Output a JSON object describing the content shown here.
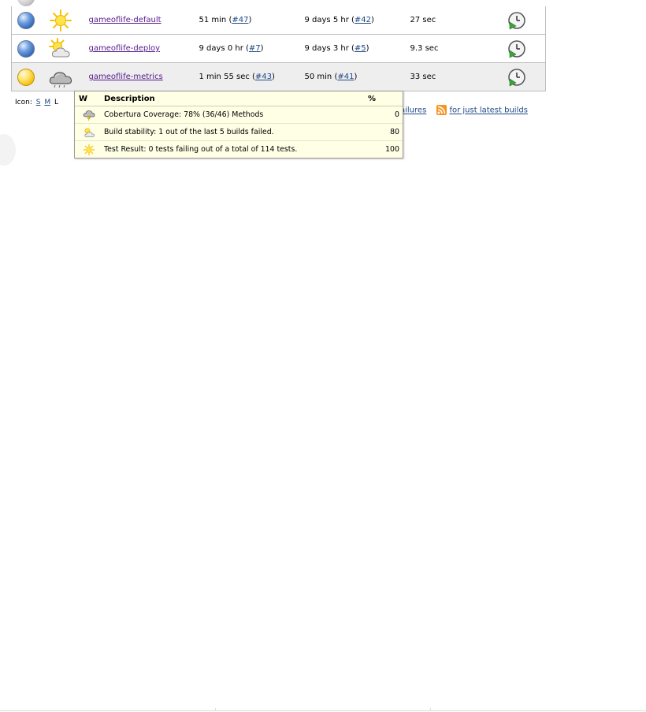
{
  "jobs": [
    {
      "status_color": "blue",
      "weather": "sunny-icon",
      "name": "gameoflife-default",
      "last_success": "51 min (",
      "last_success_build": "#47",
      "last_failure": "9 days 5 hr (",
      "last_failure_build": "#42",
      "last_duration": "27 sec"
    },
    {
      "status_color": "blue",
      "weather": "partly-cloudy-icon",
      "name": "gameoflife-deploy",
      "last_success": "9 days 0 hr (",
      "last_success_build": "#7",
      "last_failure": "9 days 3 hr (",
      "last_failure_build": "#5",
      "last_duration": "9.3 sec"
    },
    {
      "status_color": "yellow",
      "weather": "cloudy-icon",
      "name": "gameoflife-metrics",
      "last_success": "1 min 55 sec (",
      "last_success_build": "#43",
      "last_failure": "50 min (",
      "last_failure_build": "#41",
      "last_duration": "33 sec"
    }
  ],
  "paren_close": ")",
  "icon_size": {
    "label": "Icon:",
    "small": "S",
    "medium": "M",
    "large": "L"
  },
  "feeds": {
    "failures_label": "ailures",
    "latest_label": "for just latest builds"
  },
  "tooltip": {
    "headers": {
      "w": "W",
      "description": "Description",
      "percent": "%"
    },
    "rows": [
      {
        "icon": "storm-icon",
        "description": "Cobertura Coverage: 78% (36/46) Methods",
        "percent": "0"
      },
      {
        "icon": "partly-cloudy-icon",
        "description": "Build stability: 1 out of the last 5 builds failed.",
        "percent": "80"
      },
      {
        "icon": "sunny-icon",
        "description": "Test Result: 0 tests failing out of a total of 114 tests.",
        "percent": "100"
      }
    ]
  },
  "colors": {
    "link": "#204a87",
    "visited": "#551a8b",
    "tooltip_bg": "#ffffe6",
    "row_highlight": "#eeeeee"
  }
}
